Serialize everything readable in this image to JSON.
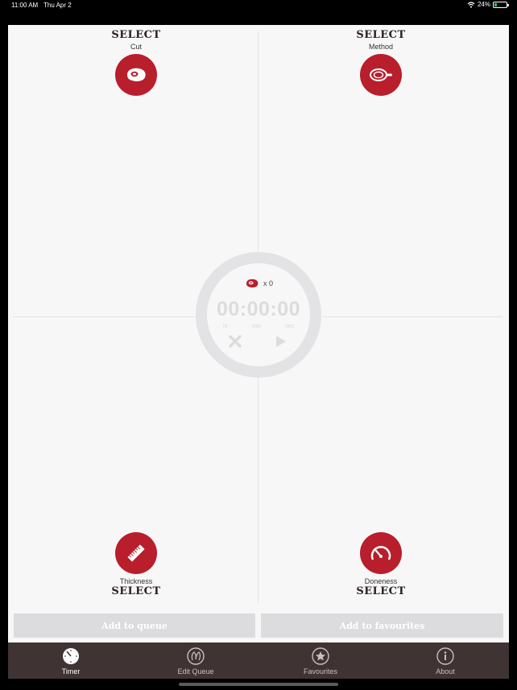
{
  "status_bar": {
    "time": "11:00 AM",
    "date": "Thu Apr 2",
    "battery_percent": "24%",
    "battery_level": 0.24,
    "icons": [
      "wifi-icon",
      "battery-charging-icon"
    ]
  },
  "colors": {
    "accent": "#b81e2c",
    "tabbar": "#3f3334",
    "background": "#f7f7f8"
  },
  "selectors": {
    "cut": {
      "action": "SELECT",
      "label": "Cut",
      "icon": "steak-icon"
    },
    "method": {
      "action": "SELECT",
      "label": "Method",
      "icon": "pan-icon"
    },
    "thickness": {
      "action": "SELECT",
      "label": "Thickness",
      "icon": "ruler-icon"
    },
    "doneness": {
      "action": "SELECT",
      "label": "Doneness",
      "icon": "gauge-icon"
    }
  },
  "timer": {
    "count": "x 0",
    "display": "00:00:00",
    "units": [
      "hr",
      "min",
      "sec"
    ]
  },
  "buttons": {
    "add_to_queue": "Add to queue",
    "add_to_favourites": "Add to favourites"
  },
  "tabs": [
    {
      "label": "Timer",
      "icon": "timer-icon",
      "active": true
    },
    {
      "label": "Edit Queue",
      "icon": "queue-icon",
      "active": false
    },
    {
      "label": "Favourites",
      "icon": "star-icon",
      "active": false
    },
    {
      "label": "About",
      "icon": "info-icon",
      "active": false
    }
  ]
}
